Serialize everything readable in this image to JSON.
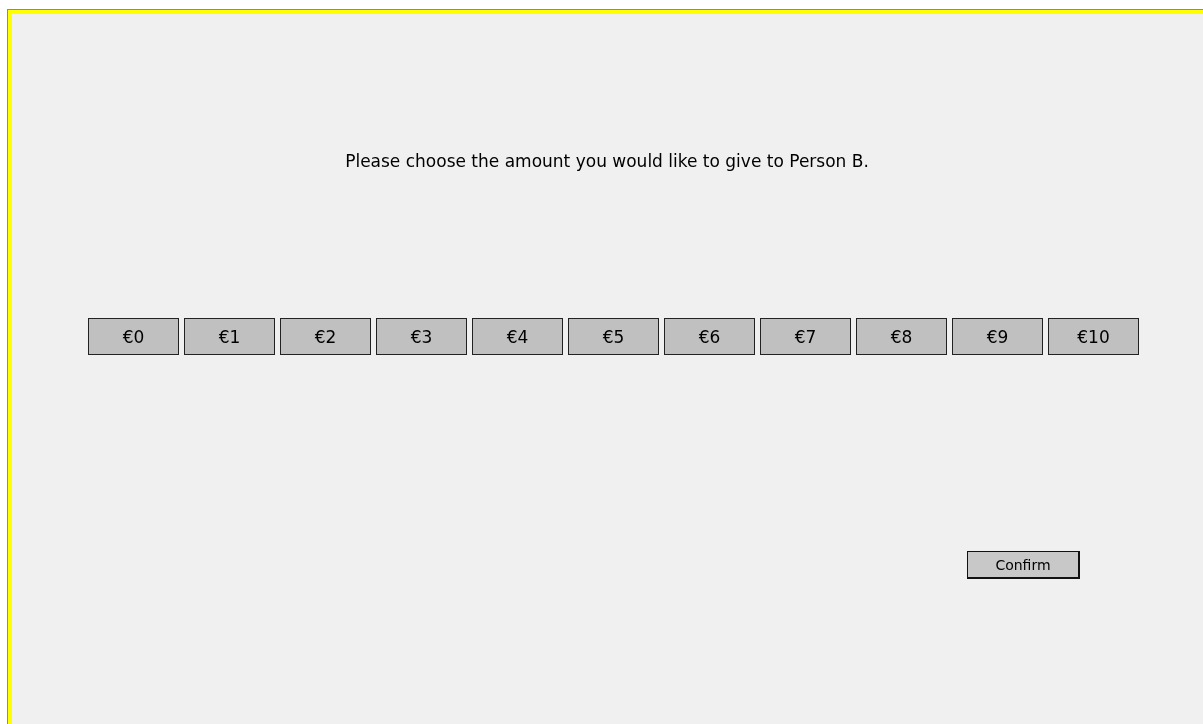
{
  "instruction": "Please choose the amount you would like to give to Person B.",
  "amounts": [
    "€0",
    "€1",
    "€2",
    "€3",
    "€4",
    "€5",
    "€6",
    "€7",
    "€8",
    "€9",
    "€10"
  ],
  "confirm_button": "Confirm"
}
